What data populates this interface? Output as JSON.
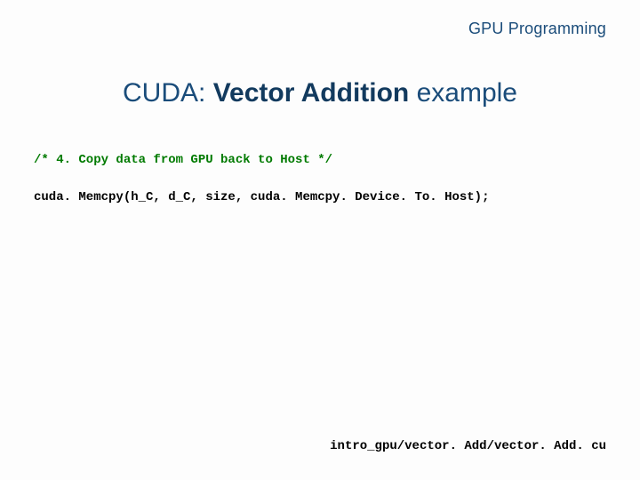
{
  "header": "GPU Programming",
  "title": {
    "prefix": "CUDA:  ",
    "bold": "Vector Addition",
    "suffix": "  example"
  },
  "code": {
    "comment": "/* 4. Copy data from GPU back to Host */",
    "line": "cuda. Memcpy(h_C, d_C, size, cuda. Memcpy. Device. To. Host);"
  },
  "footer_path": "intro_gpu/vector. Add/vector. Add. cu"
}
